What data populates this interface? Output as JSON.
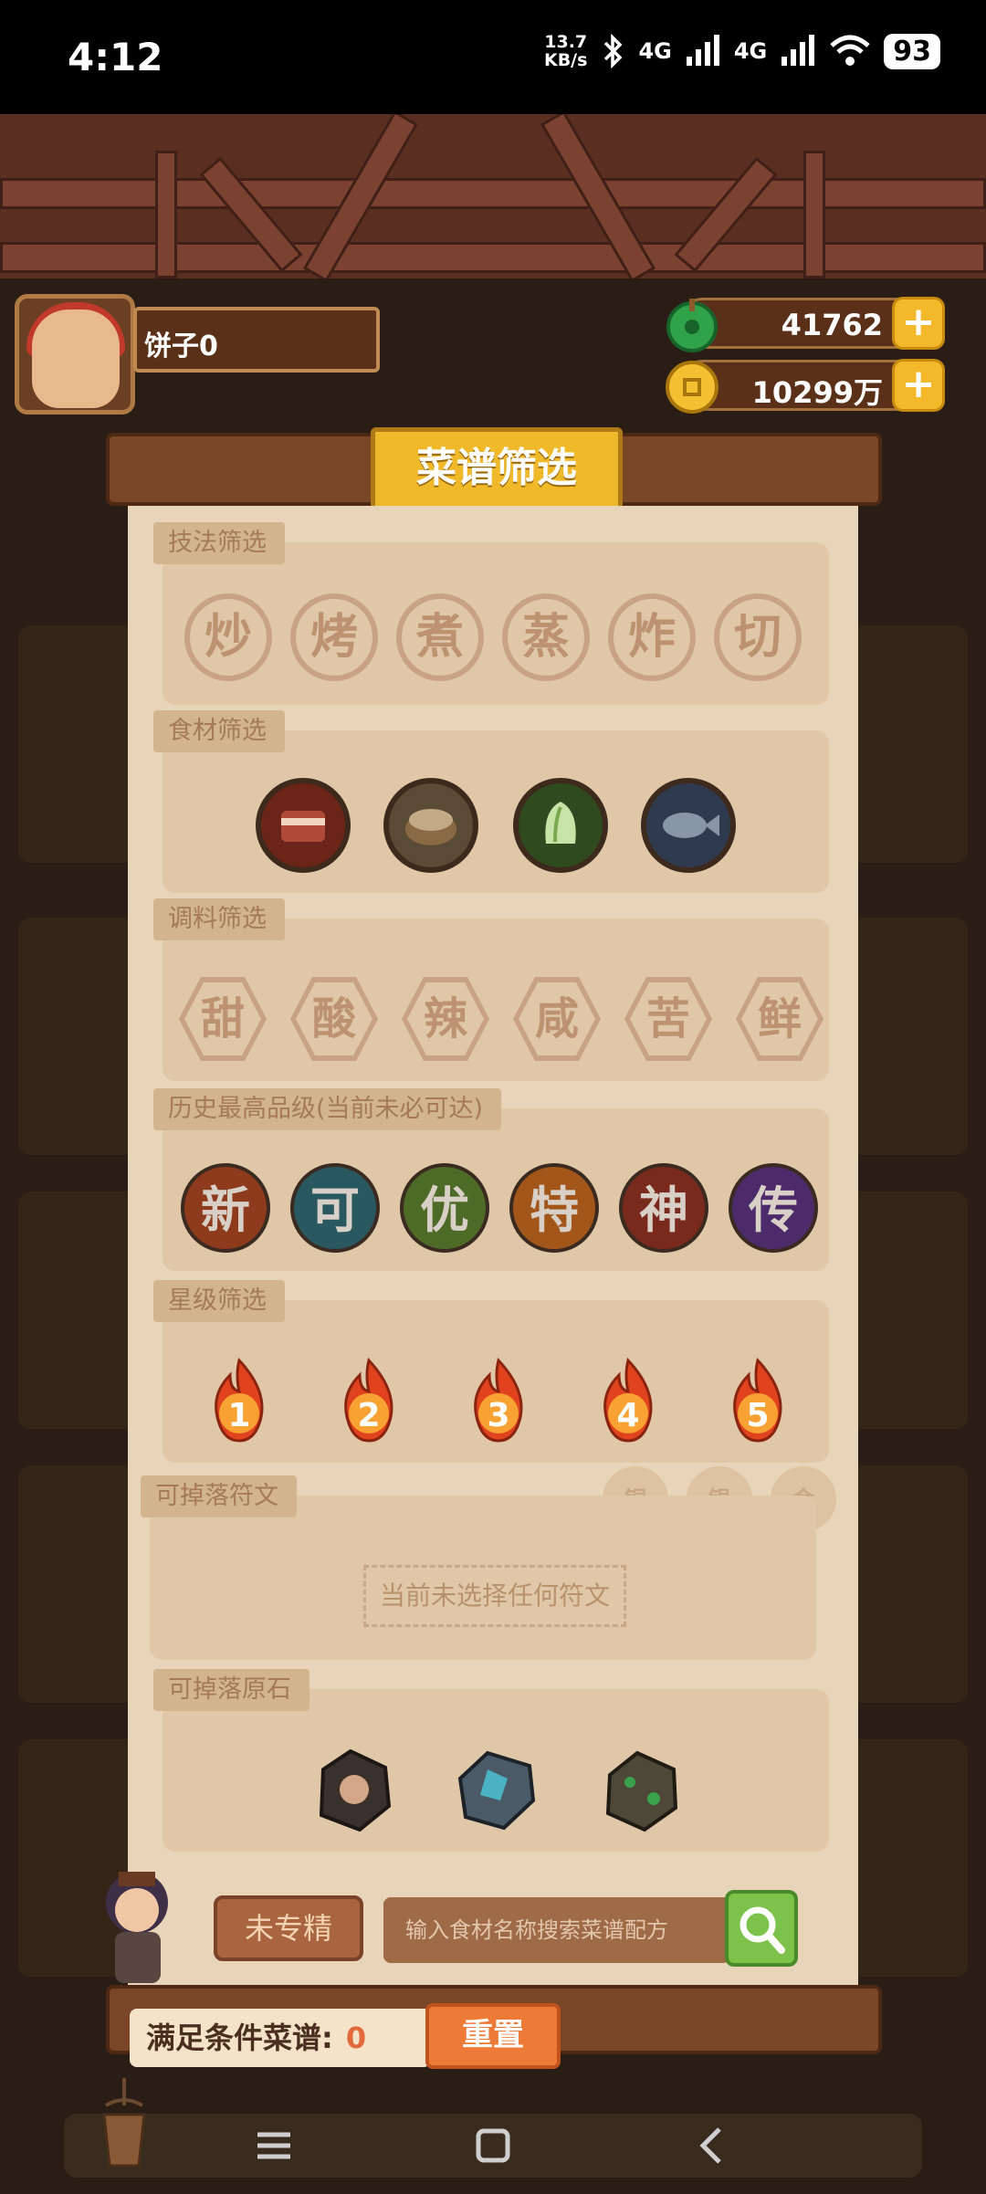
{
  "status": {
    "time": "4:12",
    "net_speed_top": "13.7",
    "net_speed_bottom": "KB/s",
    "net1": "4G",
    "net2": "4G",
    "battery": "93"
  },
  "player": {
    "name": "饼子0"
  },
  "currency": {
    "jade": "41762",
    "coins": "10299万"
  },
  "modal": {
    "title": "菜谱筛选"
  },
  "sections": {
    "technique": {
      "label": "技法筛选",
      "items": [
        "炒",
        "烤",
        "煮",
        "蒸",
        "炸",
        "切"
      ]
    },
    "ingredient": {
      "label": "食材筛选",
      "items": [
        "meat-icon",
        "grain-icon",
        "vegetable-icon",
        "fish-icon"
      ]
    },
    "seasoning": {
      "label": "调料筛选",
      "items": [
        "甜",
        "酸",
        "辣",
        "咸",
        "苦",
        "鲜"
      ]
    },
    "grade": {
      "label": "历史最高品级(当前未必可达)",
      "items": [
        "新",
        "可",
        "优",
        "特",
        "神",
        "传"
      ],
      "colors": [
        "#8e3a1c",
        "#2a5860",
        "#4d6a26",
        "#a3561a",
        "#7a2a1c",
        "#4d2a6a"
      ]
    },
    "stars": {
      "label": "星级筛选",
      "items": [
        "1",
        "2",
        "3",
        "4",
        "5"
      ]
    },
    "rune": {
      "label": "可掉落符文",
      "badges": [
        "铜",
        "银",
        "金"
      ],
      "empty_text": "当前未选择任何符文"
    },
    "stone": {
      "label": "可掉落原石"
    }
  },
  "controls": {
    "specialize_button": "未专精",
    "search_placeholder": "输入食材名称搜索菜谱配方",
    "result_label": "满足条件菜谱:",
    "result_count": "0",
    "reset_button": "重置"
  }
}
